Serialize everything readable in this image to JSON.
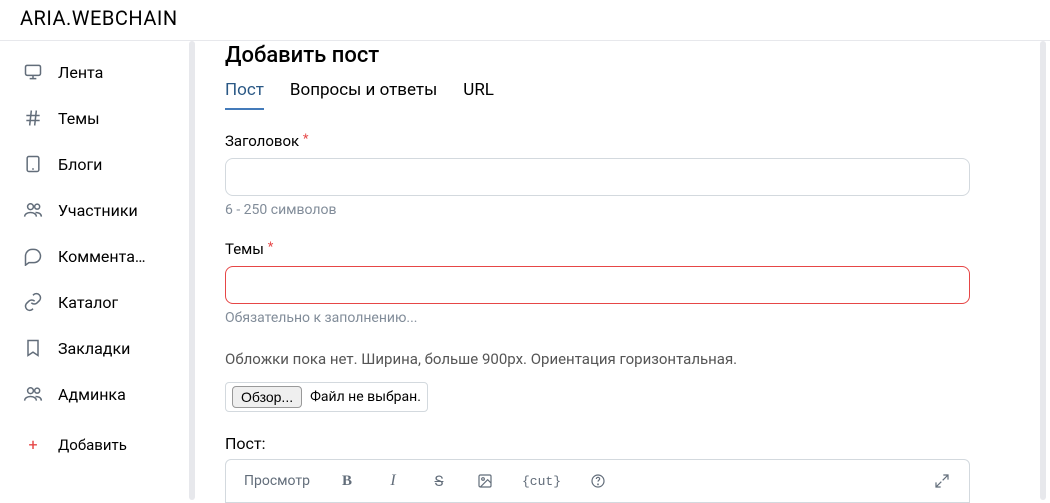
{
  "brand": "ARIA.WEBCHAIN",
  "sidebar": {
    "items": [
      {
        "label": "Лента"
      },
      {
        "label": "Темы"
      },
      {
        "label": "Блоги"
      },
      {
        "label": "Участники"
      },
      {
        "label": "Коммента…"
      },
      {
        "label": "Каталог"
      },
      {
        "label": "Закладки"
      },
      {
        "label": "Админка"
      }
    ],
    "add_label": "Добавить"
  },
  "page": {
    "title": "Добавить пост",
    "tabs": [
      {
        "label": "Пост",
        "active": true
      },
      {
        "label": "Вопросы и ответы",
        "active": false
      },
      {
        "label": "URL",
        "active": false
      }
    ]
  },
  "fields": {
    "title": {
      "label": "Заголовок",
      "value": "",
      "hint": "6 - 250 символов"
    },
    "topics": {
      "label": "Темы",
      "value": "",
      "hint": "Обязательно к заполнению..."
    },
    "cover": {
      "hint": "Обложки пока нет. Ширина, больше 900рх. Ориентация горизонтальная.",
      "browse_label": "Обзор...",
      "no_file_label": "Файл не выбран."
    },
    "post": {
      "label": "Пост:"
    }
  },
  "editor": {
    "preview_label": "Просмотр",
    "cut_label": "{cut}"
  }
}
